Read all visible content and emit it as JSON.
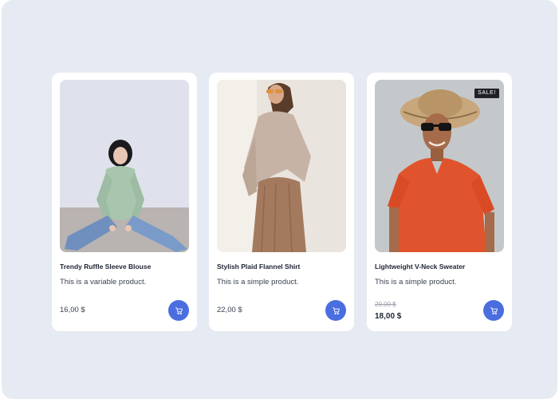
{
  "products": [
    {
      "title": "Trendy Ruffle Sleeve Blouse",
      "description": "This is a variable product.",
      "price": "16,00 $",
      "image_icon": "product-photo-woman-green-sweater"
    },
    {
      "title": "Stylish Plaid Flannel Shirt",
      "description": "This is a simple product.",
      "price": "22,00 $",
      "image_icon": "product-photo-woman-beige-outfit"
    },
    {
      "title": "Lightweight V-Neck Sweater",
      "description": "This is a simple product.",
      "old_price": "20,00 $",
      "price": "18,00 $",
      "badge": "SALE!",
      "image_icon": "product-photo-man-orange-shirt"
    }
  ],
  "cart_button_icon": "cart-icon",
  "colors": {
    "background": "#e6eaf2",
    "card": "#ffffff",
    "accent": "#4a6ee0",
    "badge": "#1f2126"
  }
}
